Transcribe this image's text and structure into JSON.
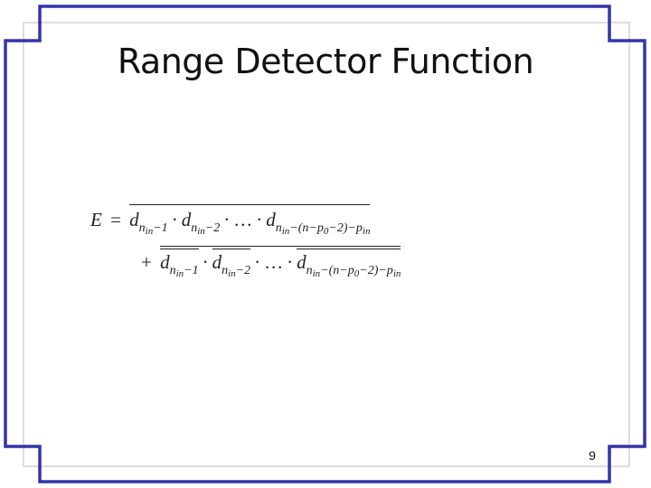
{
  "slide": {
    "title": "Range Detector Function",
    "page_number": "9"
  },
  "colors": {
    "frame_blue": "#3333aa",
    "frame_gray": "#bbbbbb",
    "text": "#222222"
  },
  "formula": {
    "lhs": "E",
    "equals": "=",
    "plus": "+",
    "dot": "·",
    "ellipsis": "…",
    "var": "d",
    "n": "n",
    "in": "in",
    "p": "p",
    "zero": "0",
    "sub_minus_1": "−1",
    "sub_minus_2": "−2",
    "sub_long": "−(n−p",
    "sub_long_end": "−2)−p"
  }
}
